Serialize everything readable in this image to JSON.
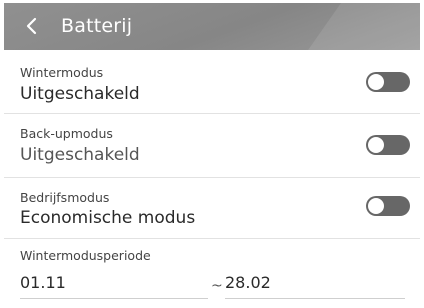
{
  "header": {
    "title": "Batterij",
    "back_icon": "chevron-left-icon"
  },
  "settings": [
    {
      "label": "Wintermodus",
      "value": "Uitgeschakeld",
      "toggle_on": false
    },
    {
      "label": "Back-upmodus",
      "value": "Uitgeschakeld",
      "toggle_on": false
    },
    {
      "label": "Bedrijfsmodus",
      "value": "Economische modus",
      "toggle_on": false
    }
  ],
  "winter_period": {
    "label": "Wintermodusperiode",
    "start": "01.11",
    "separator": "~",
    "end": "28.02"
  },
  "colors": {
    "header_bg": "#8c8c8c",
    "toggle_off": "#676767"
  }
}
